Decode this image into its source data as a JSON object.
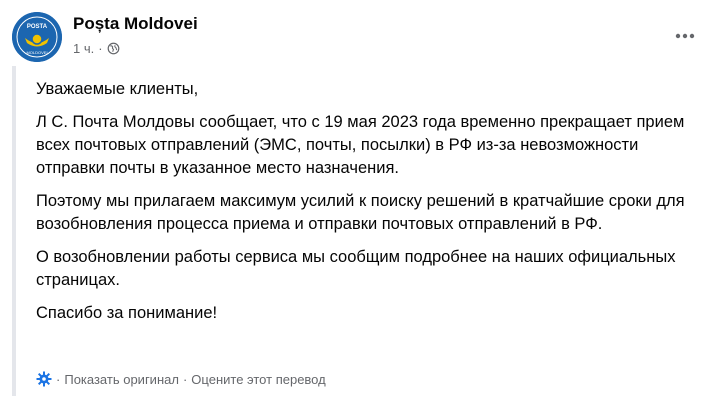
{
  "post": {
    "page_name": "Poșta Moldovei",
    "time": "1 ч.",
    "separator": "·",
    "avatar_text": "POSTA MOLDOVEI",
    "avatar_colors": {
      "background": "#1c66b0",
      "horn": "#f2c200"
    },
    "privacy_icon": "globe-icon",
    "menu_icon": "more-horizontal-icon"
  },
  "body": {
    "greeting": "Уважаемые клиенты,",
    "paragraph_1": "Л С. Почта Молдовы сообщает, что с 19 мая 2023 года временно прекращает прием всех почтовых отправлений (ЭМС, почты, посылки) в РФ из-за невозможности отправки почты в указанное место назначения.",
    "paragraph_2": "Поэтому мы прилагаем максимум усилий к поиску решений в кратчайшие сроки для возобновления процесса приема и отправки почтовых отправлений в РФ.",
    "paragraph_3": "О возобновлении работы сервиса мы сообщим подробнее на наших официальных страницах.",
    "closing": "Спасибо за понимание!"
  },
  "translation": {
    "settings_icon": "gear-icon",
    "separator": "·",
    "show_original": "Показать оригинал",
    "rate_translation": "Оцените этот перевод"
  }
}
